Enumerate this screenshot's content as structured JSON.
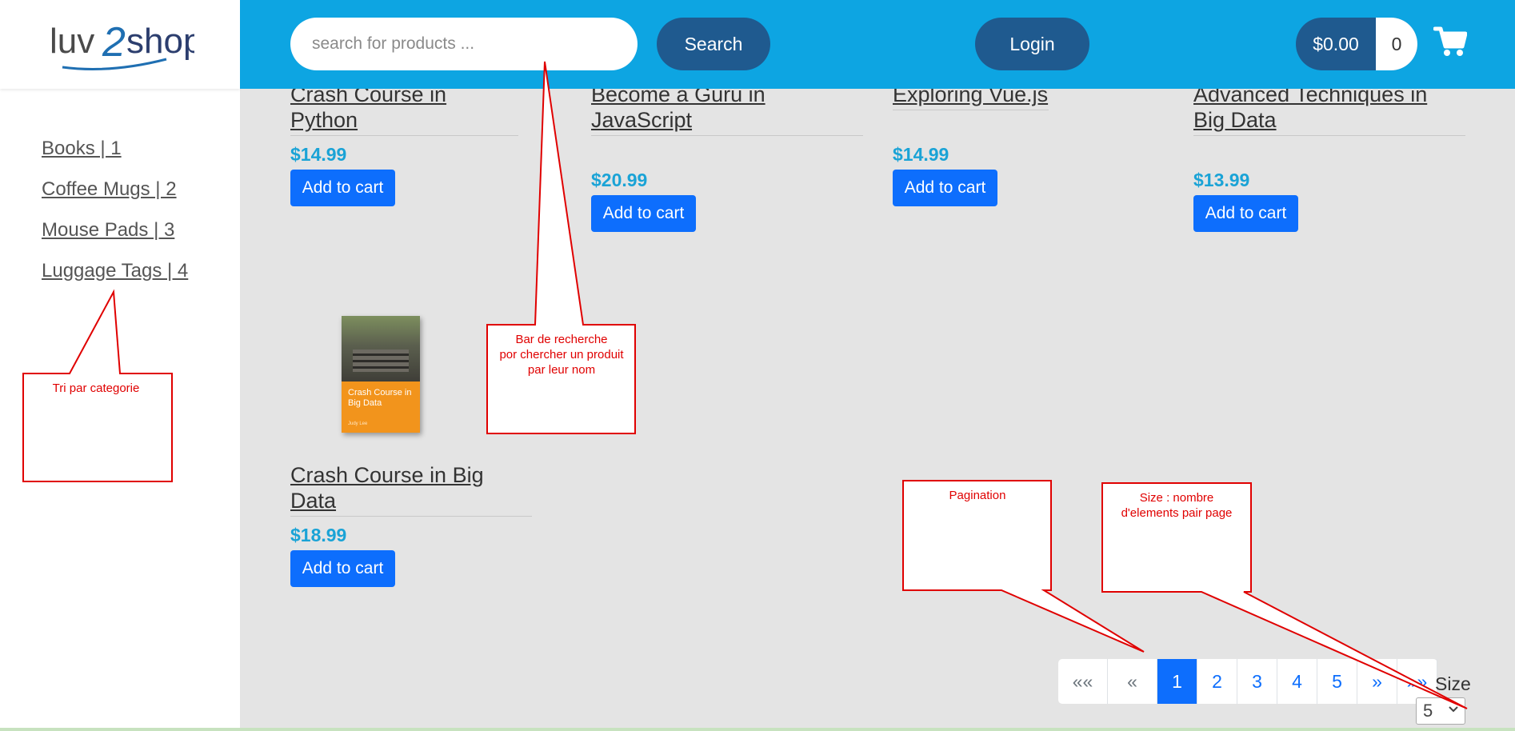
{
  "logo": {
    "text": "luv2shop"
  },
  "header": {
    "search_placeholder": "search for products ...",
    "search_button": "Search",
    "login_button": "Login",
    "cart_total": "$0.00",
    "cart_quantity": "0"
  },
  "sidebar": {
    "categories": [
      {
        "label": "Books | 1"
      },
      {
        "label": "Coffee Mugs | 2"
      },
      {
        "label": "Mouse Pads | 3"
      },
      {
        "label": "Luggage Tags | 4"
      }
    ]
  },
  "products": [
    {
      "name": "Crash Course in Python",
      "price": "$14.99",
      "button": "Add to cart"
    },
    {
      "name_line1": "Become a Guru in",
      "name_line2": "JavaScript",
      "price": "$20.99",
      "button": "Add to cart"
    },
    {
      "name": "Exploring Vue.js",
      "price": "$14.99",
      "button": "Add to cart"
    },
    {
      "name_line1": "Advanced Techniques in",
      "name_line2": "Big Data",
      "price": "$13.99",
      "button": "Add to cart"
    },
    {
      "name": "Crash Course in Big Data",
      "price": "$18.99",
      "button": "Add to cart",
      "cover_title": "Crash Course in Big Data",
      "cover_author": "Judy Lee"
    }
  ],
  "annotations": {
    "category": "Tri par categorie",
    "search_line1": "Bar de recherche",
    "search_line2": "por chercher un produit",
    "search_line3": "par leur nom",
    "pagination": "Pagination",
    "size_line1": "Size : nombre",
    "size_line2": "d'elements pair page",
    "callout_color": "#e00000"
  },
  "pagination": {
    "first": "««",
    "prev": "«",
    "pages": [
      "1",
      "2",
      "3",
      "4",
      "5"
    ],
    "active_page": "1",
    "next": "»",
    "last": "»»"
  },
  "page_size": {
    "label": "Size",
    "value": "5"
  },
  "colors": {
    "header": "#0da5e2",
    "dark_button": "#1f5a8f",
    "primary": "#0d6efd",
    "price": "#1aa3d6",
    "content_background": "#e4e4e4"
  }
}
